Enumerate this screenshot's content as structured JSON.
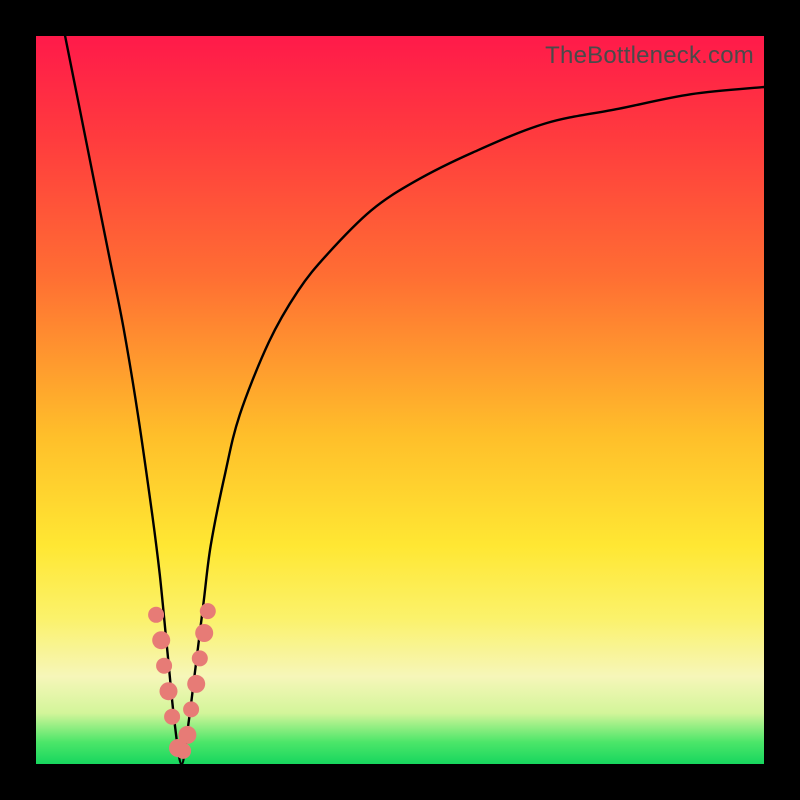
{
  "watermark": "TheBottleneck.com",
  "chart_data": {
    "type": "line",
    "title": "",
    "xlabel": "",
    "ylabel": "",
    "xlim": [
      0,
      100
    ],
    "ylim": [
      0,
      100
    ],
    "notch_x": 20,
    "series": [
      {
        "name": "bottleneck-curve",
        "x": [
          4,
          6,
          8,
          10,
          12,
          14,
          16,
          17,
          18,
          19,
          20,
          21,
          22,
          23,
          24,
          26,
          28,
          32,
          36,
          40,
          46,
          52,
          60,
          70,
          80,
          90,
          100
        ],
        "y": [
          100,
          90,
          80,
          70,
          60,
          48,
          34,
          26,
          16,
          6,
          0,
          6,
          14,
          22,
          30,
          40,
          48,
          58,
          65,
          70,
          76,
          80,
          84,
          88,
          90,
          92,
          93
        ]
      }
    ],
    "markers": {
      "name": "highlighted-points",
      "x": [
        16.5,
        17.2,
        17.6,
        18.2,
        18.7,
        19.5,
        20.2,
        20.8,
        21.3,
        22.0,
        22.5,
        23.1,
        23.6
      ],
      "y": [
        20.5,
        17.0,
        13.5,
        10.0,
        6.5,
        2.2,
        1.8,
        4.0,
        7.5,
        11.0,
        14.5,
        18.0,
        21.0
      ]
    },
    "background_gradient": {
      "top": "#ff1a4a",
      "upper_mid": "#ff6e33",
      "mid": "#ffe733",
      "lower_mid": "#f6f6b9",
      "bottom": "#17d65e"
    }
  }
}
